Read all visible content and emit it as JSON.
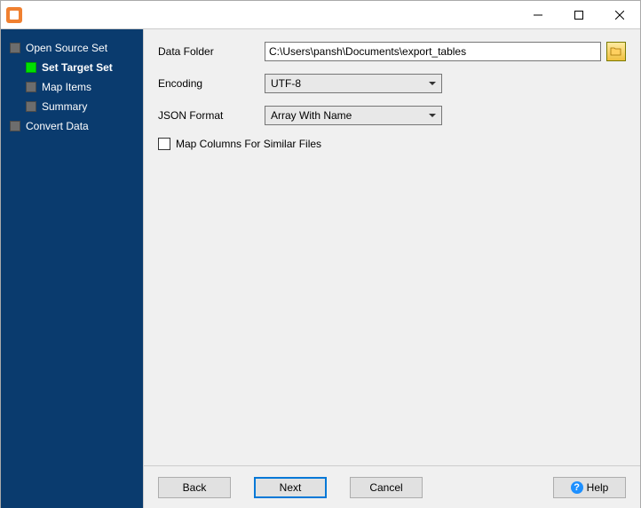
{
  "titlebar": {
    "title": ""
  },
  "sidebar": {
    "items": [
      {
        "label": "Open Source Set",
        "active": false,
        "level": 0
      },
      {
        "label": "Set Target Set",
        "active": true,
        "level": 1
      },
      {
        "label": "Map Items",
        "active": false,
        "level": 1
      },
      {
        "label": "Summary",
        "active": false,
        "level": 1
      },
      {
        "label": "Convert Data",
        "active": false,
        "level": 0
      }
    ]
  },
  "form": {
    "data_folder_label": "Data Folder",
    "data_folder_value": "C:\\Users\\pansh\\Documents\\export_tables",
    "encoding_label": "Encoding",
    "encoding_value": "UTF-8",
    "json_format_label": "JSON Format",
    "json_format_value": "Array With Name",
    "map_columns_label": "Map Columns For Similar Files",
    "map_columns_checked": false
  },
  "buttons": {
    "back": "Back",
    "next": "Next",
    "cancel": "Cancel",
    "help": "Help"
  }
}
